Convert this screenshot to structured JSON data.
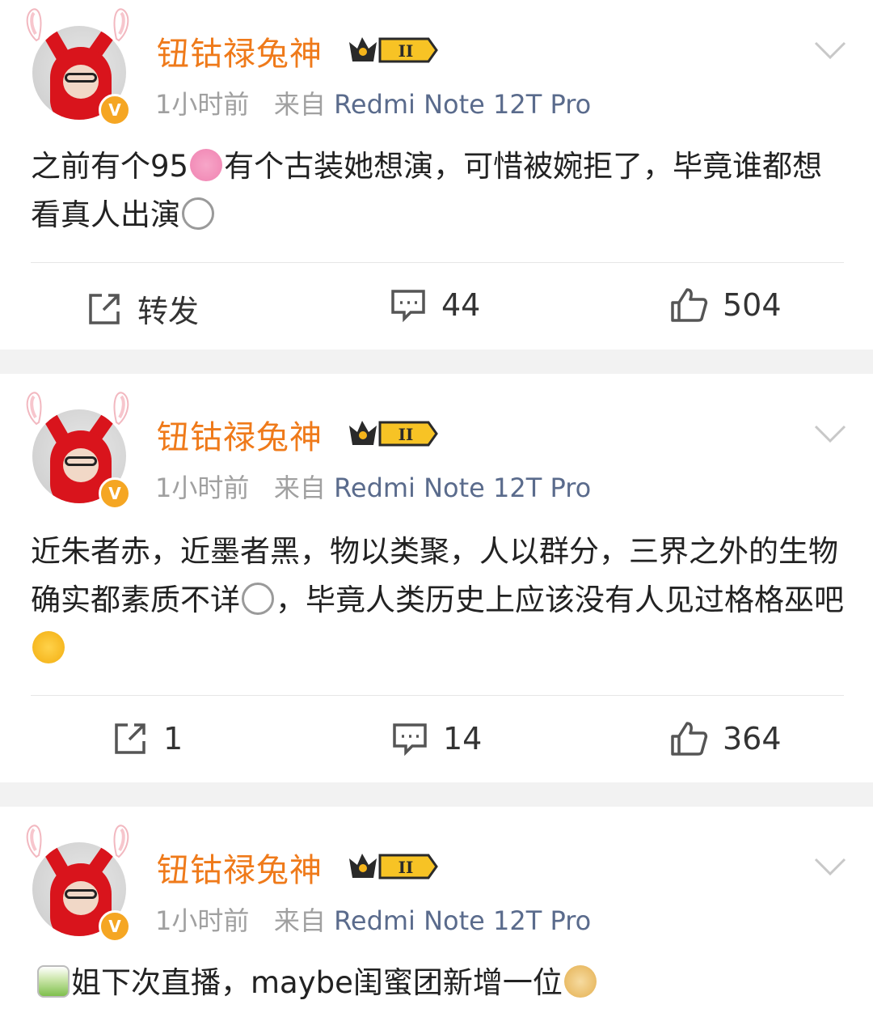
{
  "posts": [
    {
      "username": "钮钴禄兔神",
      "level_badge": "II",
      "verified_mark": "V",
      "time": "1小时前",
      "from_label": "来自",
      "source": "Redmi Note 12T Pro",
      "content_parts": [
        "之前有个95",
        "有个古装她想演，可惜被婉拒了，毕竟谁都想看真人出演"
      ],
      "emoji_names": [
        "flower-emoji",
        "doge-tongue-emoji"
      ],
      "actions": {
        "repost": "转发",
        "comments": "44",
        "likes": "504"
      }
    },
    {
      "username": "钮钴禄兔神",
      "level_badge": "II",
      "verified_mark": "V",
      "time": "1小时前",
      "from_label": "来自",
      "source": "Redmi Note 12T Pro",
      "content_parts": [
        "近朱者赤，近墨者黑，物以类聚，人以群分，三界之外的生物确实都素质不详",
        "，毕竟人类历史上应该没有人见过格格巫吧"
      ],
      "emoji_names": [
        "doge-tongue-emoji",
        "hug-emoji"
      ],
      "actions": {
        "repost": "1",
        "comments": "14",
        "likes": "364"
      }
    },
    {
      "username": "钮钴禄兔神",
      "level_badge": "II",
      "verified_mark": "V",
      "time": "1小时前",
      "from_label": "来自",
      "source": "Redmi Note 12T Pro",
      "content_parts": [
        "姐下次直播，maybe闺蜜团新增一位"
      ],
      "emoji_names": [
        "tea-emoji",
        "doge-emoji"
      ]
    }
  ],
  "colors": {
    "username": "#ef7a1a",
    "meta": "#a0a0a0",
    "source": "#5a6b8c",
    "separator": "#f2f2f2"
  }
}
